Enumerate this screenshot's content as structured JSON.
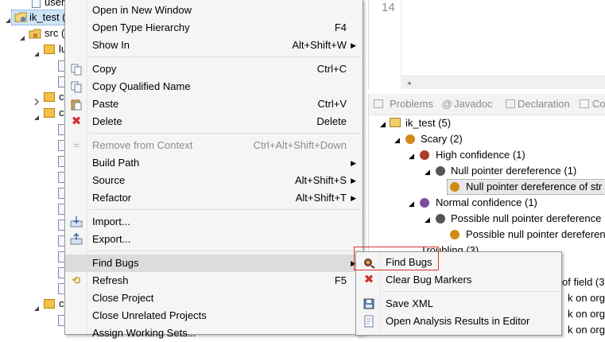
{
  "tree": {
    "top_partial": "user",
    "project": "ik_test (",
    "src": "src (",
    "items": [
      "lu",
      "c",
      "c",
      "c"
    ]
  },
  "editor": {
    "line_number": "14"
  },
  "panel": {
    "tabs": [
      "Problems",
      "Javadoc",
      "Declaration",
      "Co"
    ],
    "rows": [
      "ik_test (5)",
      "Scary (2)",
      "High confidence (1)",
      "Null pointer dereference (1)",
      "Null pointer dereference of str",
      "Normal confidence (1)",
      "Possible null pointer dereference",
      "Possible null pointer dereferen",
      "Troubling (3)",
      "of field (3)",
      "k on org.w",
      "k on org.w",
      "k on org.w"
    ]
  },
  "context_menu": {
    "items": [
      {
        "label": "Open in New Window",
        "accel": ""
      },
      {
        "label": "Open Type Hierarchy",
        "accel": "F4"
      },
      {
        "label": "Show In",
        "accel": "Alt+Shift+W"
      },
      {
        "label": "Copy",
        "accel": "Ctrl+C"
      },
      {
        "label": "Copy Qualified Name",
        "accel": ""
      },
      {
        "label": "Paste",
        "accel": "Ctrl+V"
      },
      {
        "label": "Delete",
        "accel": "Delete"
      },
      {
        "label": "Remove from Context",
        "accel": "Ctrl+Alt+Shift+Down"
      },
      {
        "label": "Build Path",
        "accel": ""
      },
      {
        "label": "Source",
        "accel": "Alt+Shift+S"
      },
      {
        "label": "Refactor",
        "accel": "Alt+Shift+T"
      },
      {
        "label": "Import...",
        "accel": ""
      },
      {
        "label": "Export...",
        "accel": ""
      },
      {
        "label": "Find Bugs",
        "accel": ""
      },
      {
        "label": "Refresh",
        "accel": "F5"
      },
      {
        "label": "Close Project",
        "accel": ""
      },
      {
        "label": "Close Unrelated Projects",
        "accel": ""
      },
      {
        "label": "Assign Working Sets...",
        "accel": ""
      }
    ]
  },
  "submenu": {
    "items": [
      {
        "label": "Find Bugs"
      },
      {
        "label": "Clear Bug Markers"
      },
      {
        "label": "Save XML"
      },
      {
        "label": "Open Analysis Results in Editor"
      }
    ]
  },
  "colors": {
    "highlight": "#dcdcdc",
    "red_box": "#d9302c",
    "delete_icon": "#d0312d",
    "tab_text": "#8a8a8a"
  }
}
